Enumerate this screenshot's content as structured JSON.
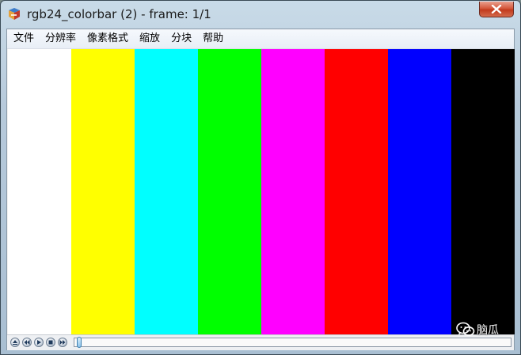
{
  "window": {
    "title": "rgb24_colorbar (2) - frame: 1/1",
    "app_icon": "app-logo-icon",
    "close_icon": "close-icon"
  },
  "menu": {
    "items": [
      "文件",
      "分辨率",
      "像素格式",
      "缩放",
      "分块",
      "帮助"
    ]
  },
  "colorbars": [
    {
      "name": "white",
      "color": "#ffffff"
    },
    {
      "name": "yellow",
      "color": "#ffff00"
    },
    {
      "name": "cyan",
      "color": "#00ffff"
    },
    {
      "name": "green",
      "color": "#00ff00"
    },
    {
      "name": "magenta",
      "color": "#ff00ff"
    },
    {
      "name": "red",
      "color": "#ff0000"
    },
    {
      "name": "blue",
      "color": "#0000ff"
    },
    {
      "name": "black",
      "color": "#000000"
    }
  ],
  "playback": {
    "buttons": [
      "eject-icon",
      "rewind-icon",
      "play-icon",
      "stop-icon",
      "fast-forward-icon"
    ],
    "position": 0.0
  },
  "watermark": {
    "icon": "wechat-icon",
    "text": "脑瓜"
  }
}
